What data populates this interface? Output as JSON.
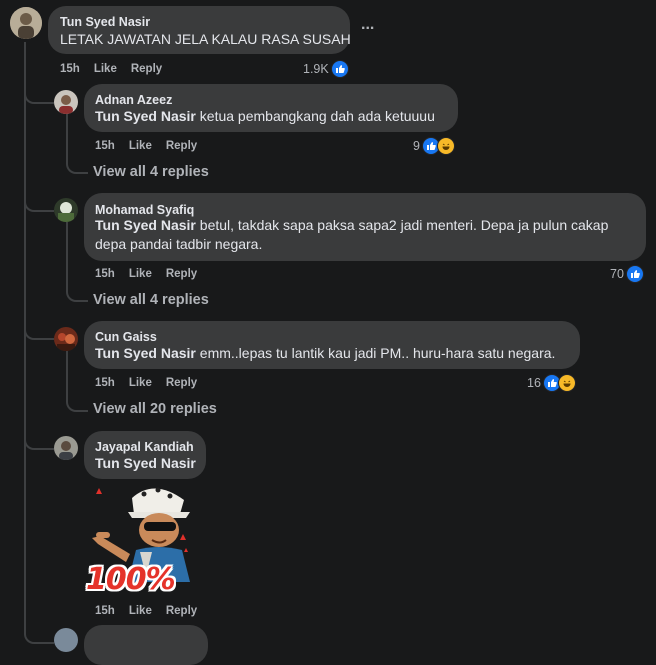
{
  "root": {
    "author": "Tun Syed Nasir",
    "text": "LETAK JAWATAN JELA KALAU RASA SUSAH",
    "more": "...",
    "time": "15h",
    "like": "Like",
    "reply": "Reply",
    "reactions": "1.9K"
  },
  "replies": [
    {
      "author": "Adnan Azeez",
      "mention": "Tun Syed Nasir",
      "text": " ketua pembangkang dah ada ketuuuu",
      "time": "15h",
      "like": "Like",
      "reply": "Reply",
      "reactions": "9",
      "view_all": "View all 4 replies"
    },
    {
      "author": "Mohamad Syafiq",
      "mention": "Tun Syed Nasir",
      "text": " betul, takdak sapa paksa sapa2 jadi menteri. Depa ja pulun cakap depa pandai tadbir negara.",
      "time": "15h",
      "like": "Like",
      "reply": "Reply",
      "reactions": "70",
      "view_all": "View all 4 replies"
    },
    {
      "author": "Cun Gaiss",
      "mention": "Tun Syed Nasir",
      "text": " emm..lepas tu lantik kau jadi PM.. huru-hara satu negara.",
      "time": "15h",
      "like": "Like",
      "reply": "Reply",
      "reactions": "16",
      "view_all": "View all 20 replies"
    },
    {
      "author": "Jayapal Kandiah",
      "mention": "Tun Syed Nasir",
      "text": "",
      "sticker_text": "100%",
      "time": "15h",
      "like": "Like",
      "reply": "Reply"
    }
  ],
  "colors": {
    "like": "#1877f2",
    "haha": "#f7b928",
    "bubble": "#3a3b3c",
    "background": "#18191a"
  }
}
